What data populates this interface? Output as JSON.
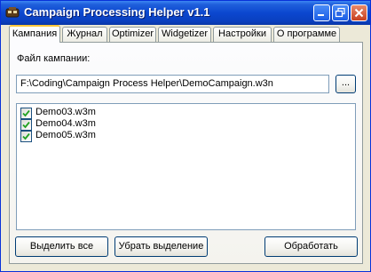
{
  "window": {
    "title": "Campaign Processing Helper v1.1",
    "accent_color": "#0b47cf"
  },
  "titlebar": {
    "icons": [
      "minimize-icon",
      "restore-icon",
      "close-icon"
    ]
  },
  "tabs": [
    {
      "label": "Кампания",
      "active": true
    },
    {
      "label": "Журнал",
      "active": false
    },
    {
      "label": "Optimizer",
      "active": false
    },
    {
      "label": "Widgetizer",
      "active": false
    },
    {
      "label": "Настройки",
      "active": false
    },
    {
      "label": "О программе",
      "active": false
    }
  ],
  "campaign": {
    "file_label": "Файл кампании:",
    "file_path": "F:\\Coding\\Campaign Process Helper\\DemoCampaign.w3n",
    "browse_label": "...",
    "maps": [
      {
        "name": "Demo03.w3m",
        "checked": true
      },
      {
        "name": "Demo04.w3m",
        "checked": true
      },
      {
        "name": "Demo05.w3m",
        "checked": true
      }
    ]
  },
  "buttons": {
    "select_all": "Выделить все",
    "deselect": "Убрать выделение",
    "process": "Обработать"
  }
}
